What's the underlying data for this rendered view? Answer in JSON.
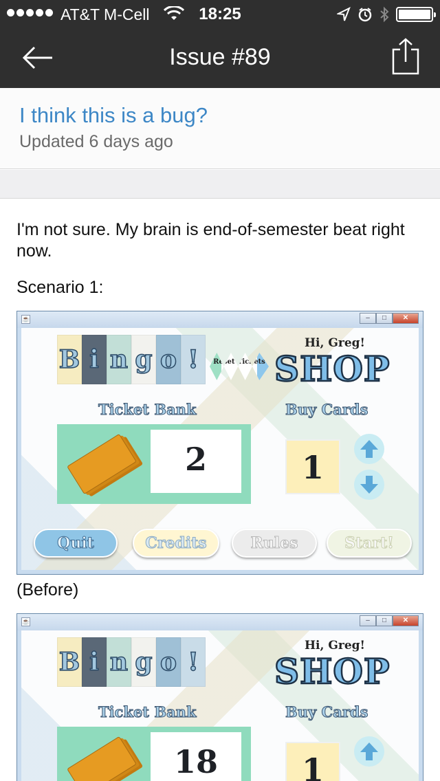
{
  "status_bar": {
    "carrier": "AT&T M-Cell",
    "time": "18:25"
  },
  "nav": {
    "title": "Issue #89"
  },
  "issue": {
    "title": "I think this is a bug?",
    "updated": "Updated 6 days ago"
  },
  "body": {
    "paragraph1": "I'm not sure. My brain is end-of-semester beat right now.",
    "paragraph2": "Scenario 1:",
    "caption1": "(Before)"
  },
  "screenshots": [
    {
      "logo_letters": [
        "B",
        "i",
        "n",
        "g",
        "o",
        "!"
      ],
      "logo_colors": [
        "#f6ecc1",
        "#5a6877",
        "#c2dfd7",
        "#f2f2ee",
        "#9fc0d6",
        "#c9dce8"
      ],
      "reset_label": "Reset Tickets",
      "greeting": "Hi, Greg!",
      "shop_label": "SHOP",
      "ticket_bank_label": "Ticket Bank",
      "buy_cards_label": "Buy Cards",
      "ticket_count": "2",
      "buy_count": "1",
      "buttons": {
        "quit": "Quit",
        "credits": "Credits",
        "rules": "Rules",
        "start": "Start!"
      }
    },
    {
      "logo_letters": [
        "B",
        "i",
        "n",
        "g",
        "o",
        "!"
      ],
      "logo_colors": [
        "#f6ecc1",
        "#5a6877",
        "#c2dfd7",
        "#f2f2ee",
        "#9fc0d6",
        "#c9dce8"
      ],
      "greeting": "Hi, Greg!",
      "shop_label": "SHOP",
      "ticket_bank_label": "Ticket Bank",
      "buy_cards_label": "Buy Cards",
      "ticket_count": "18",
      "buy_count": "1"
    }
  ]
}
